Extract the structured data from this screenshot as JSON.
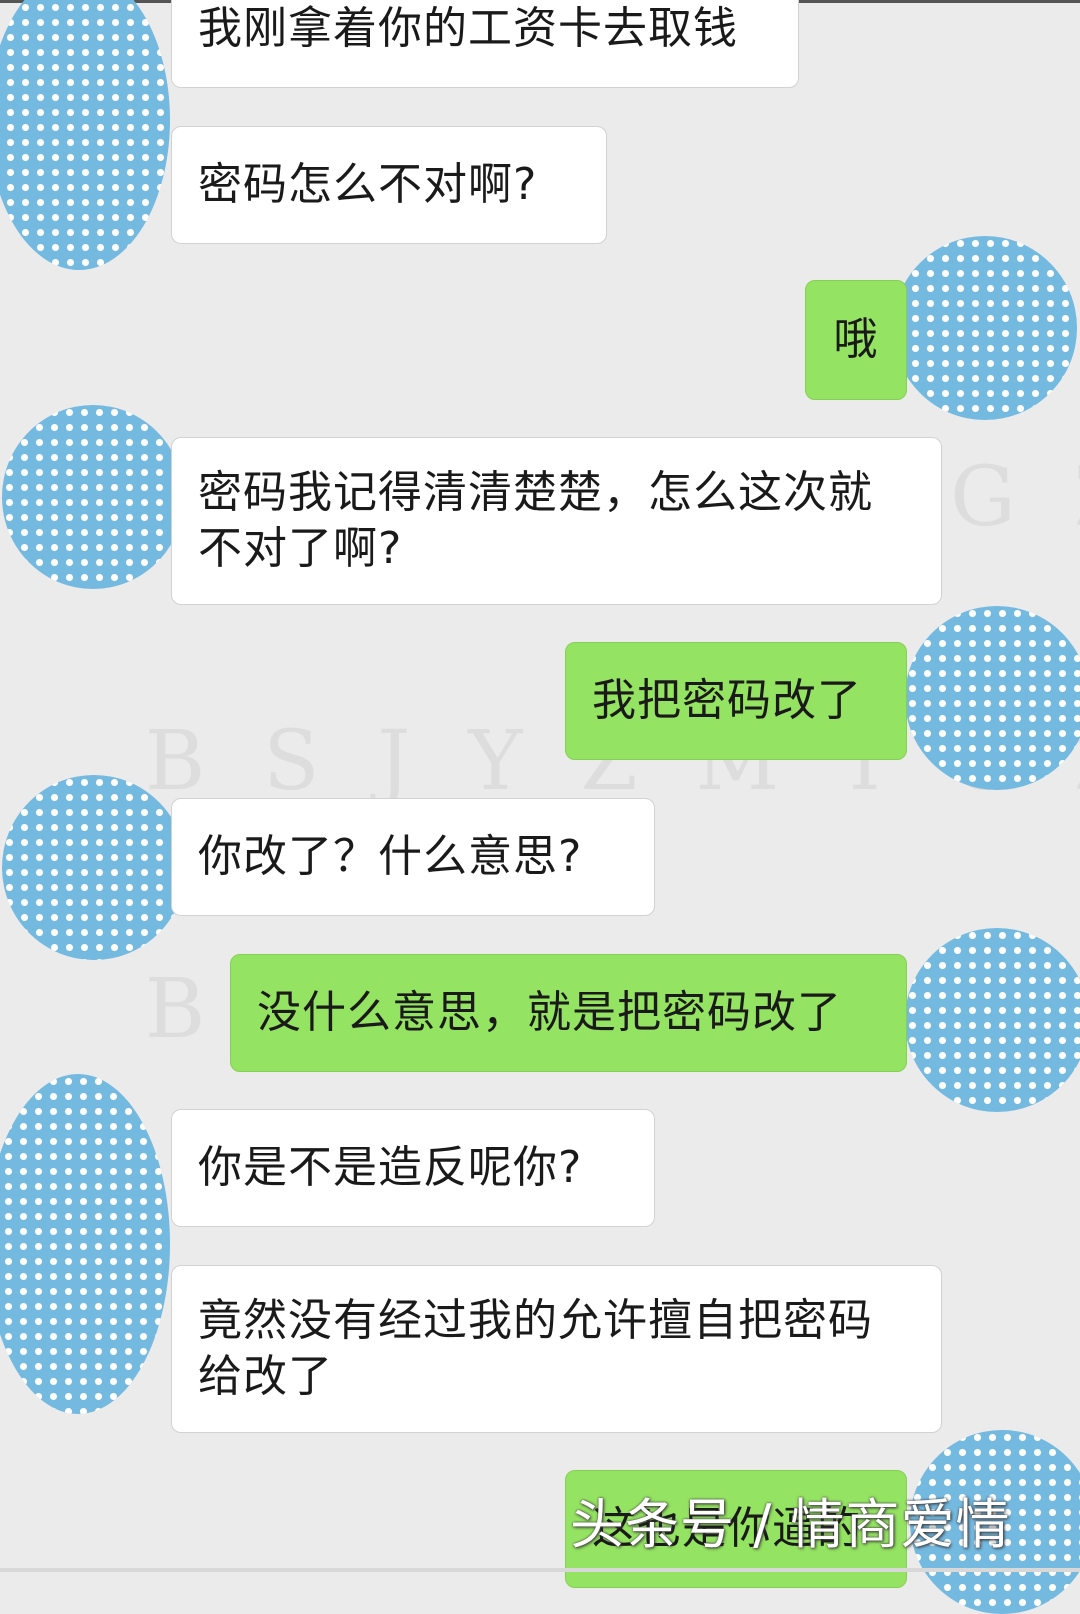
{
  "colors": {
    "background": "#ebebeb",
    "incoming_bubble": "#ffffff",
    "outgoing_bubble": "#95e362",
    "avatar_dots": "#74b9e0"
  },
  "avatar_icon": "polka-dot-avatar",
  "messages": [
    {
      "side": "incoming",
      "text": "我刚拿着你的工资卡去取钱"
    },
    {
      "side": "incoming",
      "text": "密码怎么不对啊?"
    },
    {
      "side": "outgoing",
      "text": "哦"
    },
    {
      "side": "incoming",
      "text": "密码我记得清清楚楚，怎么这次就不对了啊?"
    },
    {
      "side": "outgoing",
      "text": "我把密码改了"
    },
    {
      "side": "incoming",
      "text": "你改了？什么意思?"
    },
    {
      "side": "outgoing",
      "text": "没什么意思，就是把密码改了"
    },
    {
      "side": "incoming",
      "text": "你是不是造反呢你?"
    },
    {
      "side": "incoming",
      "text": "竟然没有经过我的允许擅自把密码给改了"
    },
    {
      "side": "outgoing",
      "text": "这也是你逼的"
    }
  ],
  "watermarks": {
    "text": "BSJYZMTGZS",
    "footer": "头条号 / 情商爱情"
  }
}
